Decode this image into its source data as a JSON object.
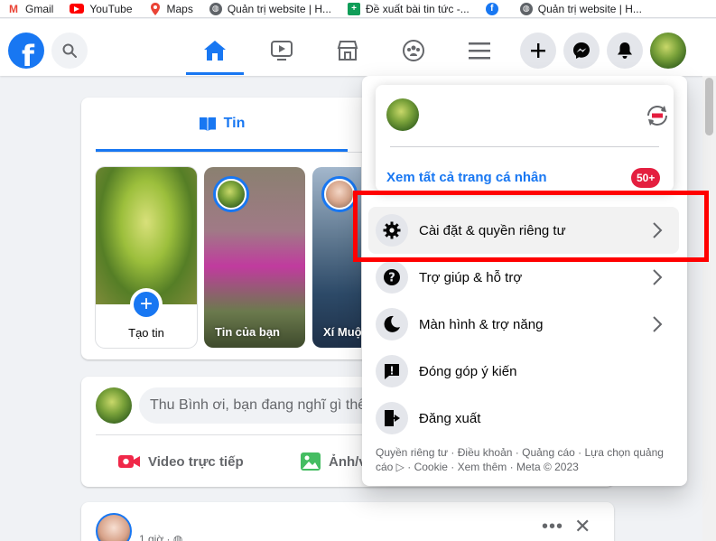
{
  "bookmarks": [
    {
      "label": "Gmail",
      "icon": "gmail-icon"
    },
    {
      "label": "YouTube",
      "icon": "youtube-icon"
    },
    {
      "label": "Maps",
      "icon": "maps-icon"
    },
    {
      "label": "Quản trị website | H...",
      "icon": "globe-icon"
    },
    {
      "label": "Đề xuất bài tin tức -...",
      "icon": "sheets-icon"
    },
    {
      "label": "",
      "icon": "facebook-icon"
    },
    {
      "label": "Quản trị website | H...",
      "icon": "globe-icon"
    }
  ],
  "nav": {
    "logo_letter": "f",
    "tabs": [
      "home-icon",
      "video-icon",
      "marketplace-icon",
      "groups-icon",
      "menu-icon"
    ],
    "actions": [
      "plus-icon",
      "messenger-icon",
      "notifications-icon"
    ]
  },
  "stories": {
    "tab_label": "Tin",
    "create_label": "Tạo tin",
    "create_plus": "+",
    "items": [
      {
        "label": "Tin của bạn"
      },
      {
        "label": "Xí Muội"
      }
    ]
  },
  "composer": {
    "placeholder": "Thu Bình ơi, bạn đang nghĩ gì thế?",
    "actions": [
      {
        "label": "Video trực tiếp",
        "icon": "live-video-icon",
        "color": "#f02849"
      },
      {
        "label": "Ảnh/video",
        "icon": "photo-icon",
        "color": "#45bd62"
      }
    ]
  },
  "post": {
    "meta": "1 giờ · ",
    "more": "•••",
    "close": "✕"
  },
  "menu": {
    "see_all": "Xem tất cả trang cá nhân",
    "badge": "50+",
    "items": [
      {
        "label": "Cài đặt & quyền riêng tư",
        "icon": "settings-icon",
        "chevron": true
      },
      {
        "label": "Trợ giúp & hỗ trợ",
        "icon": "help-icon",
        "chevron": true
      },
      {
        "label": "Màn hình & trợ năng",
        "icon": "moon-icon",
        "chevron": true
      },
      {
        "label": "Đóng góp ý kiến",
        "icon": "feedback-icon",
        "chevron": false
      },
      {
        "label": "Đăng xuất",
        "icon": "logout-icon",
        "chevron": false
      }
    ],
    "footer": "Quyền riêng tư · Điều khoản · Quảng cáo · Lựa chọn quảng cáo ▷ · Cookie · Xem thêm · Meta © 2023"
  },
  "colors": {
    "brand": "#1877f2",
    "highlight": "#ff0000",
    "badge": "#e41e3f"
  }
}
